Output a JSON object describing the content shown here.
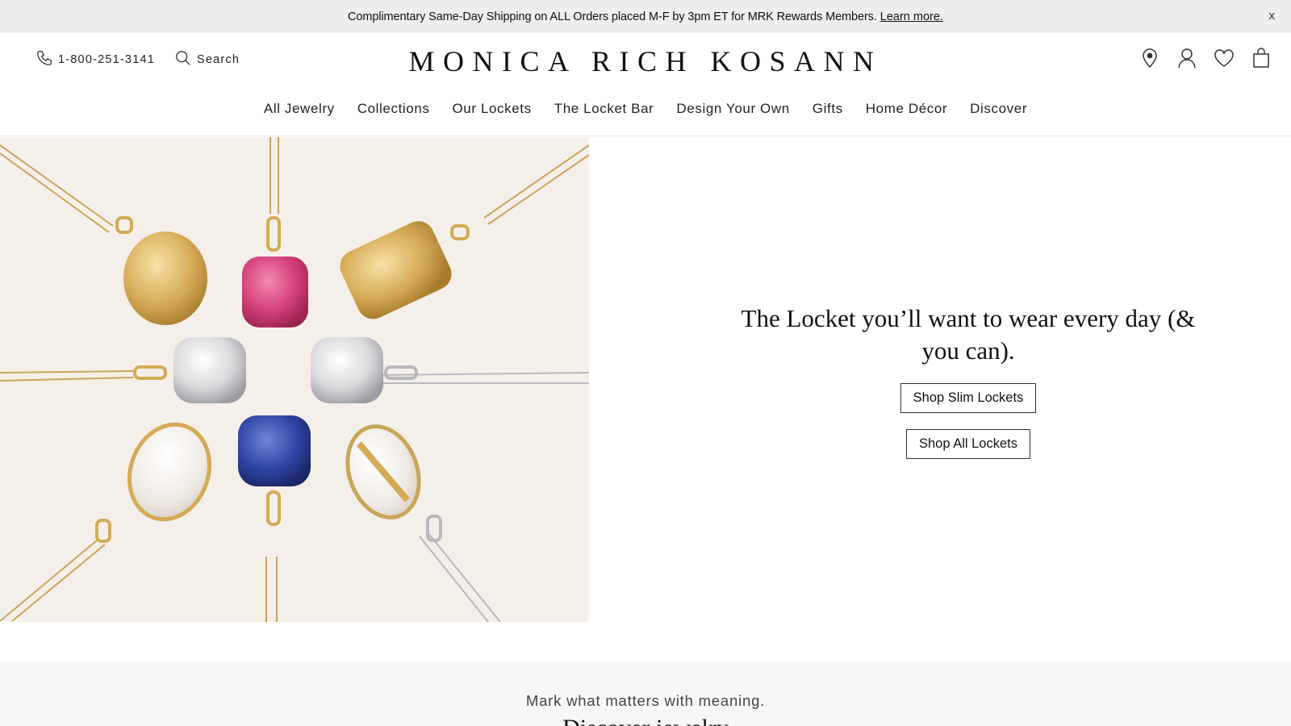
{
  "promo": {
    "text": "Complimentary Same-Day Shipping on ALL Orders placed M-F by 3pm ET for MRK Rewards Members.",
    "link": "Learn more.",
    "close": "x"
  },
  "header": {
    "phone": "1-800-251-3141",
    "search_label": "Search",
    "brand": "MONICA RICH KOSANN",
    "icons": [
      "location-icon",
      "account-icon",
      "wishlist-icon",
      "bag-icon"
    ]
  },
  "nav": {
    "items": [
      "All Jewelry",
      "Collections",
      "Our Lockets",
      "The Locket Bar",
      "Design Your Own",
      "Gifts",
      "Home Décor",
      "Discover"
    ]
  },
  "hero": {
    "headline": "The Locket you’ll want to wear every day (& you can).",
    "button_primary": "Shop Slim Lockets",
    "button_secondary": "Shop All Lockets"
  },
  "section": {
    "tagline": "Mark what matters with meaning.",
    "heading": "Discover jewelry"
  },
  "colors": {
    "promo_bg": "#eeeeee",
    "hero_bg": "#f5efea",
    "band_bg": "#f7f7f7",
    "gold": "#d4aa55"
  }
}
